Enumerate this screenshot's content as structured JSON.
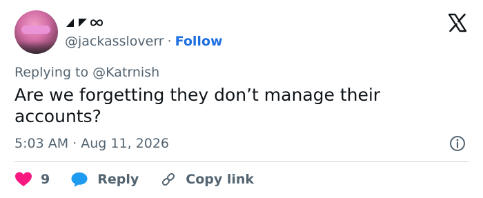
{
  "author": {
    "handle": "@jackassloverr",
    "separator": "·",
    "follow_label": "Follow",
    "display_name_icons": [
      "triangle-up-icon",
      "triangle-down-icon",
      "infinity-icon"
    ]
  },
  "reply_context": {
    "prefix": "Replying to",
    "mention": "@Katrnish"
  },
  "tweet": {
    "text": "Are we forgetting they don’t manage their accounts?",
    "time": "5:03 AM",
    "separator": "·",
    "date": "Aug 11, 2026"
  },
  "actions": {
    "like_count": "9",
    "reply_label": "Reply",
    "copy_link_label": "Copy link"
  },
  "colors": {
    "text": "#0f1419",
    "muted": "#536471",
    "link": "#1d6fe0",
    "like": "#f91880",
    "reply": "#1d9bf0",
    "divider": "#cfd9de"
  },
  "icons": {
    "brand": "x-logo-icon",
    "info": "info-icon",
    "like": "heart-icon",
    "reply": "speech-bubble-icon",
    "copy_link": "link-icon"
  }
}
